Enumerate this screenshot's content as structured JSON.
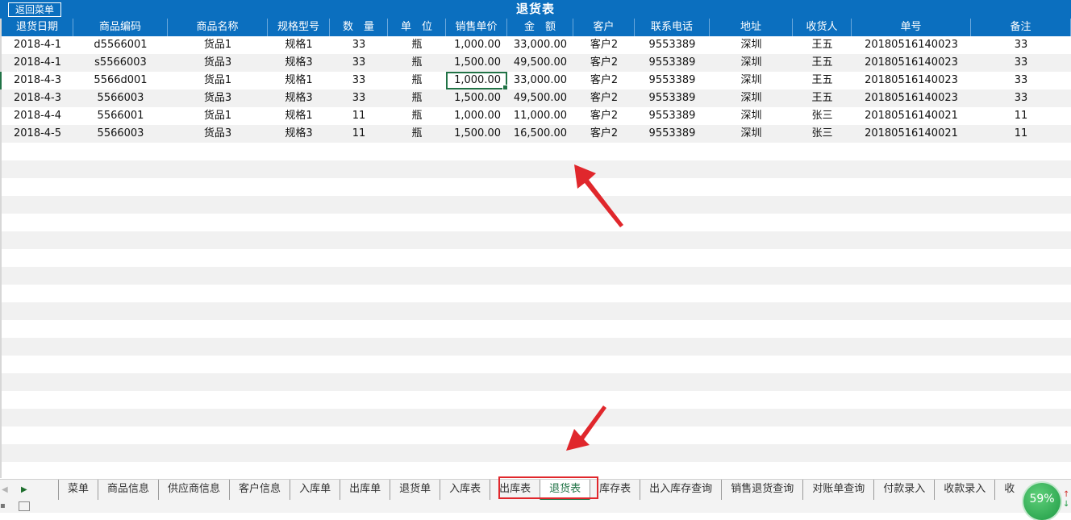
{
  "header": {
    "back_button": "返回菜单",
    "title": "退货表"
  },
  "table": {
    "columns": [
      "退货日期",
      "商品编码",
      "商品名称",
      "规格型号",
      "数　量",
      "单　位",
      "销售单价",
      "金　额",
      "客户",
      "联系电话",
      "地址",
      "收货人",
      "单号",
      "备注"
    ],
    "rows": [
      [
        "2018-4-1",
        "d5566001",
        "货品1",
        "规格1",
        "33",
        "瓶",
        "1,000.00",
        "33,000.00",
        "客户2",
        "9553389",
        "深圳",
        "王五",
        "20180516140023",
        "33"
      ],
      [
        "2018-4-1",
        "s5566003",
        "货品3",
        "规格3",
        "33",
        "瓶",
        "1,500.00",
        "49,500.00",
        "客户2",
        "9553389",
        "深圳",
        "王五",
        "20180516140023",
        "33"
      ],
      [
        "2018-4-3",
        "5566d001",
        "货品1",
        "规格1",
        "33",
        "瓶",
        "1,000.00",
        "33,000.00",
        "客户2",
        "9553389",
        "深圳",
        "王五",
        "20180516140023",
        "33"
      ],
      [
        "2018-4-3",
        "5566003",
        "货品3",
        "规格3",
        "33",
        "瓶",
        "1,500.00",
        "49,500.00",
        "客户2",
        "9553389",
        "深圳",
        "王五",
        "20180516140023",
        "33"
      ],
      [
        "2018-4-4",
        "5566001",
        "货品1",
        "规格1",
        "11",
        "瓶",
        "1,000.00",
        "11,000.00",
        "客户2",
        "9553389",
        "深圳",
        "张三",
        "20180516140021",
        "11"
      ],
      [
        "2018-4-5",
        "5566003",
        "货品3",
        "规格3",
        "11",
        "瓶",
        "1,500.00",
        "16,500.00",
        "客户2",
        "9553389",
        "深圳",
        "张三",
        "20180516140021",
        "11"
      ]
    ],
    "empty_rows": 19
  },
  "sheet_tabs": {
    "items": [
      "菜单",
      "商品信息",
      "供应商信息",
      "客户信息",
      "入库单",
      "出库单",
      "退货单",
      "入库表",
      "出库表",
      "退货表",
      "库存表",
      "出入库存查询",
      "销售退货查询",
      "对账单查询",
      "付款录入",
      "收款录入",
      "收"
    ],
    "active": "退货表"
  },
  "status": {
    "zoom": "59%"
  },
  "colors": {
    "header_blue": "#0b6fbf",
    "excel_green": "#217346",
    "annotation_red": "#e0272c"
  }
}
